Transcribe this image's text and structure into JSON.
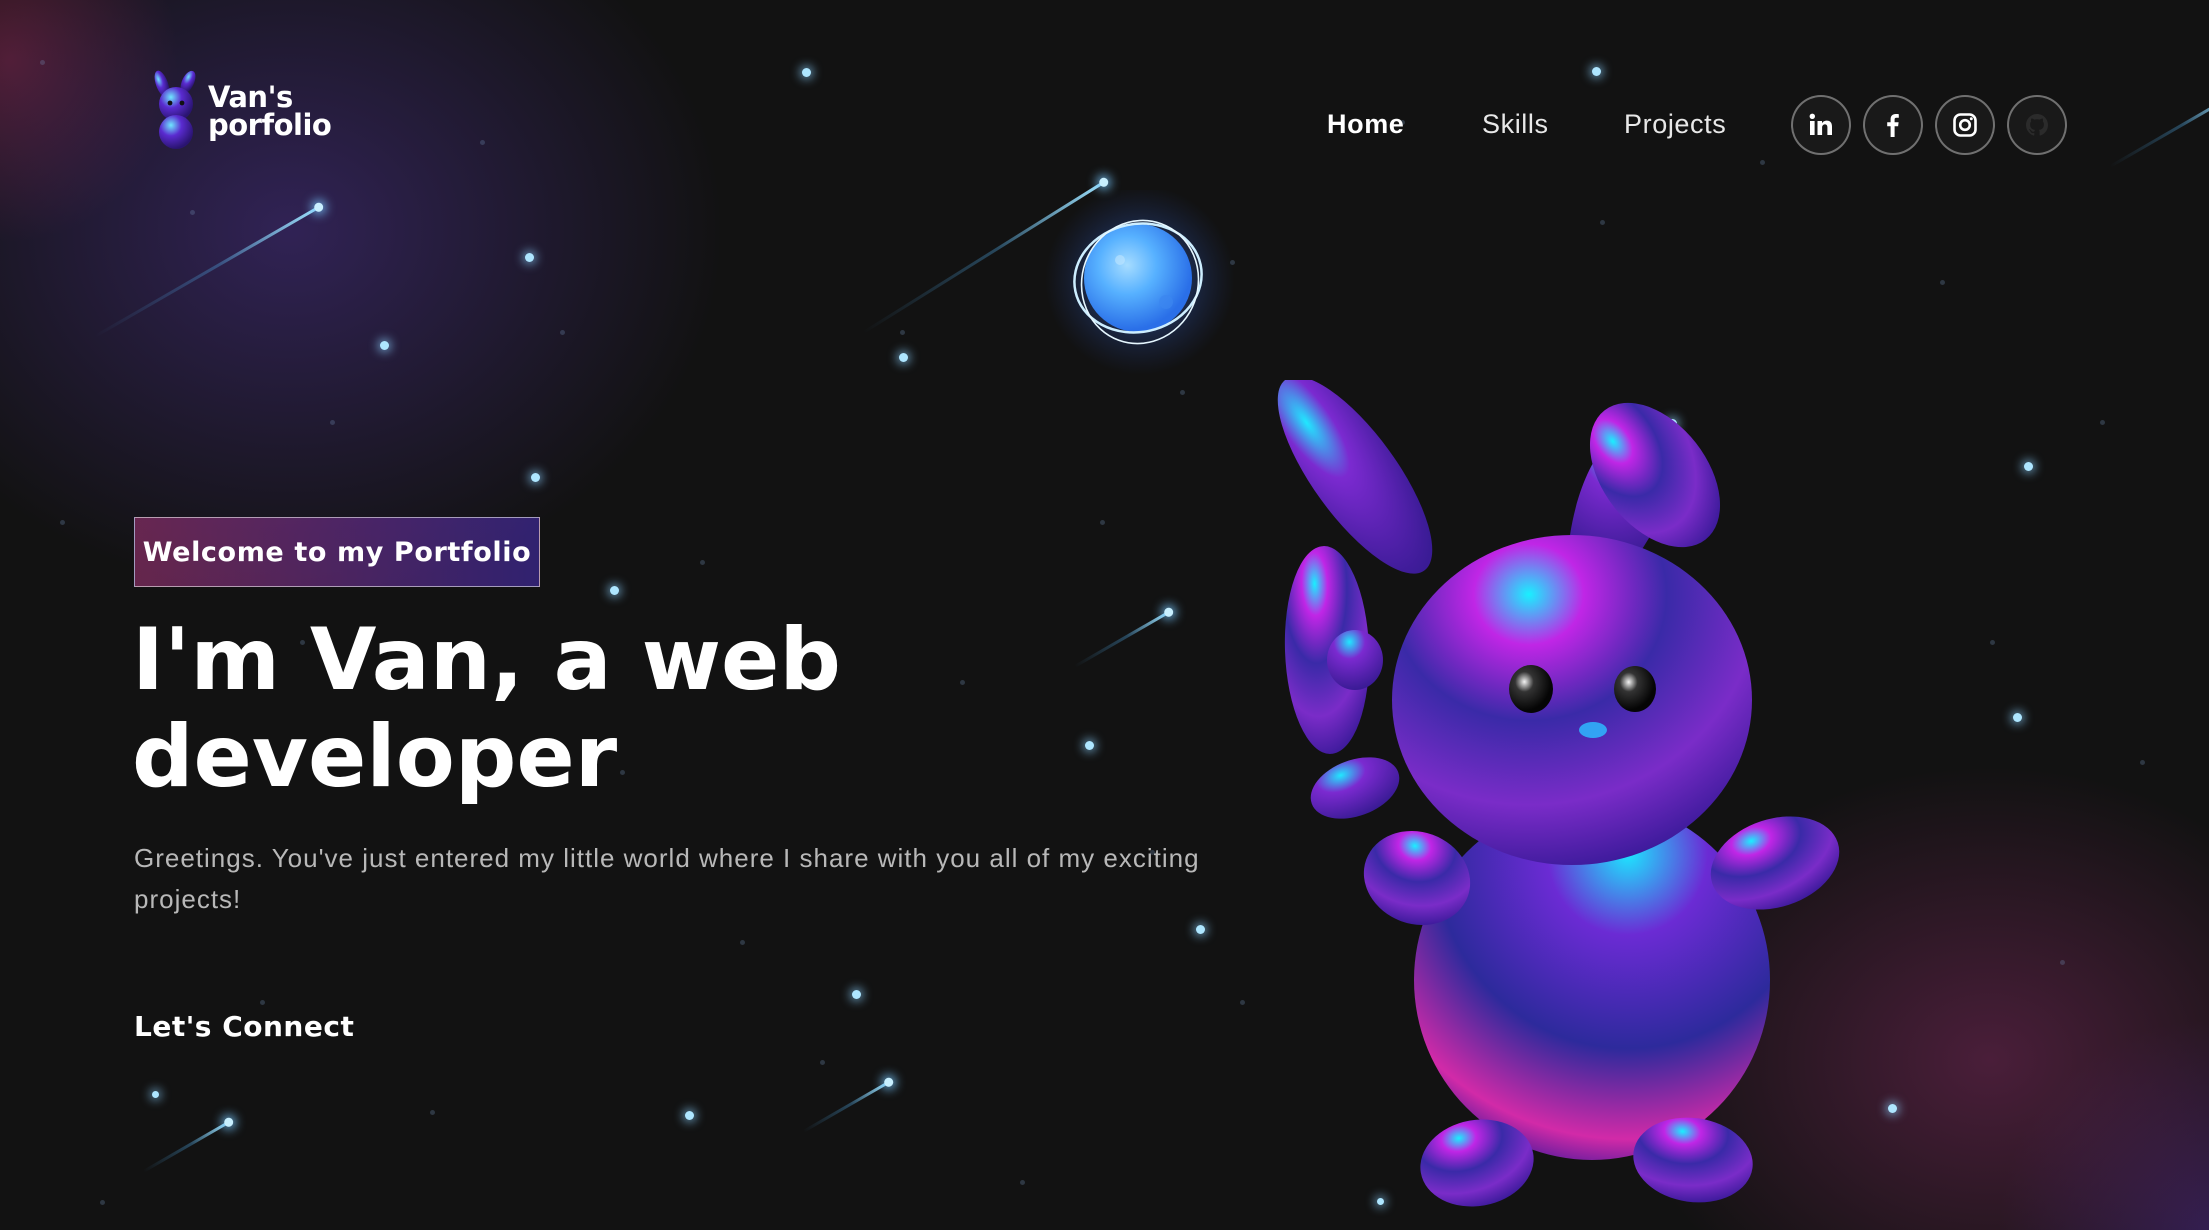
{
  "brand": {
    "name_line1": "Van's",
    "name_line2": "porfolio",
    "logo_icon": "bunny-logo-icon"
  },
  "nav": {
    "links": [
      {
        "label": "Home",
        "active": true
      },
      {
        "label": "Skills",
        "active": false
      },
      {
        "label": "Projects",
        "active": false
      }
    ],
    "social": [
      {
        "name": "LinkedIn",
        "icon": "linkedin-icon"
      },
      {
        "name": "Facebook",
        "icon": "facebook-icon"
      },
      {
        "name": "Instagram",
        "icon": "instagram-icon"
      },
      {
        "name": "GitHub",
        "icon": "github-icon"
      }
    ]
  },
  "hero": {
    "badge": "Welcome to my Portfolio",
    "headline_line1": "I'm Van, a web",
    "headline_line2": "developer",
    "intro": "Greetings. You've just entered my little world where I share with you all of my exciting projects!",
    "cta": "Let's Connect"
  },
  "illustrations": {
    "planet": "glowing-planet-illustration",
    "mascot": "3d-bunny-illustration"
  },
  "colors": {
    "background": "#121212",
    "badge_gradient_start": "#aa367c",
    "badge_gradient_end": "#4a2fbd",
    "star": "#aee6ff",
    "text_muted": "#b8b8b8"
  }
}
